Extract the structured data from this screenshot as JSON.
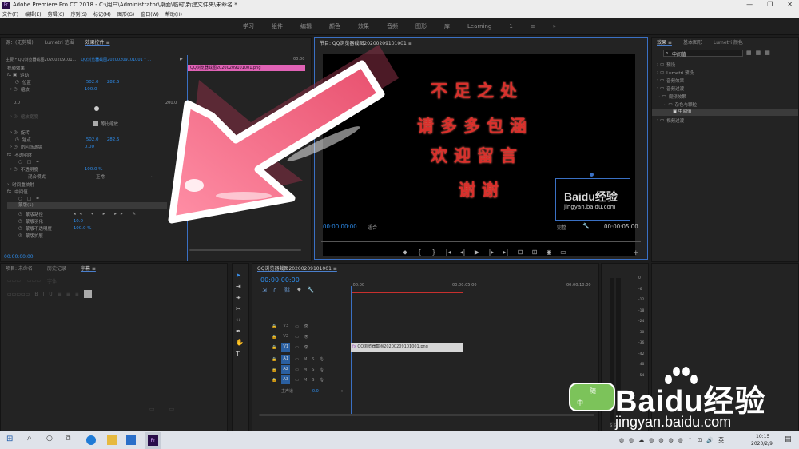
{
  "window": {
    "title": "Adobe Premiere Pro CC 2018 - C:\\用户\\Administrator\\桌面\\临时\\新建文件夹\\未命名 *",
    "app_badge": "Pr",
    "controls": [
      "—",
      "❐",
      "✕"
    ]
  },
  "menu": [
    "文件(F)",
    "编辑(E)",
    "剪辑(C)",
    "序列(S)",
    "标记(M)",
    "图形(G)",
    "窗口(W)",
    "帮助(H)"
  ],
  "workspaces": [
    "学习",
    "组件",
    "编辑",
    "颜色",
    "效果",
    "音频",
    "图形",
    "库",
    "Learning",
    "1",
    "≡",
    "»"
  ],
  "effect_controls": {
    "tabs": [
      "源：(无剪辑)",
      "Lumetri 范围",
      "效果控件 ≡"
    ],
    "master": "主要 * QQ浏览器截图20200209101...",
    "sequence": "QQ浏览器截图20200209101001 * ...",
    "time_start": "▶",
    "time_end": "00:00",
    "clip_name": "QQ浏览器截图20200209101001.png",
    "video_effects": "视频效果",
    "motion": "运动",
    "position_label": "位置",
    "position_x": "502.0",
    "position_y": "282.5",
    "scale_label": "缩放",
    "scale_value": "100.0",
    "slider_min": "0.0",
    "slider_max": "200.0",
    "scale_width_label": "缩放宽度",
    "uniform_scale": "等比缩放",
    "rotation_label": "旋转",
    "anchor_label": "锚点",
    "anchor_x": "502.0",
    "anchor_y": "282.5",
    "anti_flicker_label": "防闪烁滤镜",
    "anti_flicker_value": "0.00",
    "opacity_section": "不透明度",
    "opacity_label": "不透明度",
    "opacity_value": "100.0 %",
    "blend_label": "混合模式",
    "blend_value": "正常",
    "time_remap": "时间重映射",
    "median": "中间值",
    "mask_label": "蒙版(1)",
    "mask_path": "蒙版路径",
    "mask_feather": "蒙版羽化",
    "mask_feather_value": "10.0",
    "mask_opacity": "蒙版不透明度",
    "mask_opacity_value": "100.0 %",
    "mask_expand": "蒙版扩展",
    "timecode": "00:00:00:00"
  },
  "program_monitor": {
    "title": "节目: QQ浏览器截图20200209101001 ≡",
    "lines": [
      "不足之处",
      "请多多包涵",
      "欢迎留言",
      "谢谢"
    ],
    "watermark_brand": "Baidu经验",
    "watermark_url": "jingyan.baidu.com",
    "timecode_left": "00:00:00:00",
    "fit": "适合",
    "quality": "完整",
    "timecode_right": "00:00:05:00"
  },
  "effects_panel": {
    "tabs": [
      "效果 ≡",
      "基本图形",
      "Lumetri 颜色"
    ],
    "search_value": "中间值",
    "tree": [
      "预设",
      "Lumetri 预设",
      "音频效果",
      "音频过渡",
      "视频效果",
      "杂色与颗粒",
      "中间值",
      "视频过渡"
    ]
  },
  "project_panel": {
    "tabs": [
      "项目: 未命名",
      "历史记录",
      "字幕 ≡"
    ],
    "font_placeholder": "字体"
  },
  "timeline": {
    "sequence_name": "QQ浏览器截图20200209101001 ≡",
    "timecode": "00:00:00:00",
    "ruler": [
      ":00:00",
      "00:00:05:00",
      "00:00:10:00"
    ],
    "tracks": [
      {
        "id": "V3",
        "kind": "video",
        "on": false
      },
      {
        "id": "V2",
        "kind": "video",
        "on": false
      },
      {
        "id": "V1",
        "kind": "video",
        "on": true
      },
      {
        "id": "A1",
        "kind": "audio",
        "on": true
      },
      {
        "id": "A2",
        "kind": "audio",
        "on": true
      },
      {
        "id": "A3",
        "kind": "audio",
        "on": true
      }
    ],
    "master_label": "主声道",
    "master_value": "0.0",
    "clip_label": "QQ浏览器截图20200209101001.png"
  },
  "audio_meter": {
    "ticks": [
      "0",
      "-6",
      "-12",
      "-18",
      "-24",
      "-30",
      "-36",
      "-42",
      "-48",
      "-54"
    ],
    "bottom": "S S"
  },
  "watermark": {
    "badge_top": "随",
    "badge_bottom": "中",
    "brand": "Baidu经验",
    "url": "jingyan.baidu.com"
  },
  "taskbar": {
    "time": "10:15",
    "date": "2020/2/9",
    "lang": "英"
  },
  "colors": {
    "accent": "#2d8ceb",
    "red_text": "#d9302c",
    "arrow_pink": "#f4758f"
  }
}
